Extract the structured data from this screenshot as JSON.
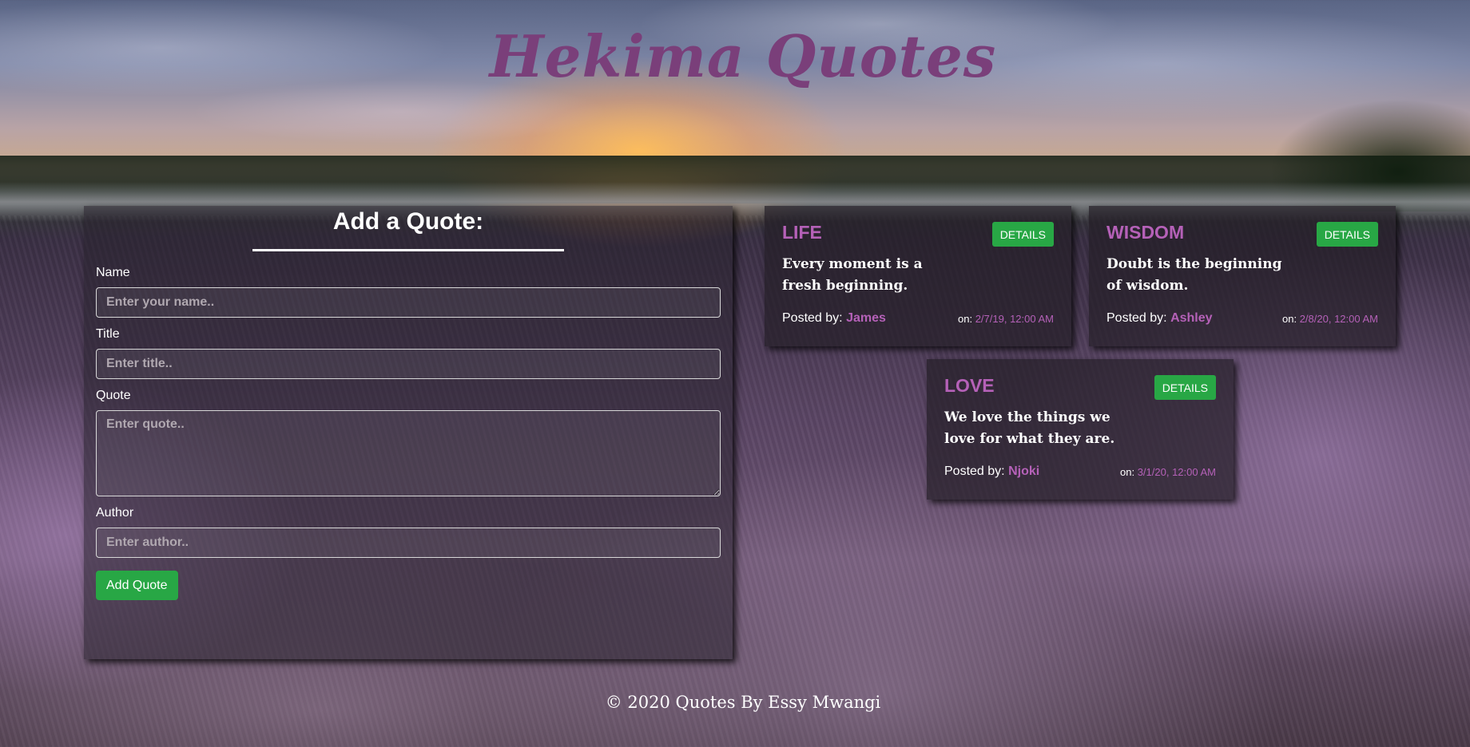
{
  "header": {
    "title": "Hekima Quotes"
  },
  "form": {
    "heading": "Add a Quote:",
    "name_label": "Name",
    "name_placeholder": "Enter your name..",
    "title_label": "Title",
    "title_placeholder": "Enter title..",
    "quote_label": "Quote",
    "quote_placeholder": "Enter quote..",
    "author_label": "Author",
    "author_placeholder": "Enter author..",
    "submit_label": "Add Quote"
  },
  "quotes": [
    {
      "title": "LIFE",
      "details_label": "DETAILS",
      "text": "Every moment is a fresh beginning.",
      "posted_by_label": "Posted by:",
      "author": "James",
      "on_label": "on:",
      "date": "2/7/19, 12:00 AM"
    },
    {
      "title": "WISDOM",
      "details_label": "DETAILS",
      "text": "Doubt is the beginning of wisdom.",
      "posted_by_label": "Posted by:",
      "author": "Ashley",
      "on_label": "on:",
      "date": "2/8/20, 12:00 AM"
    },
    {
      "title": "LOVE",
      "details_label": "DETAILS",
      "text": "We love the things we love for what they are.",
      "posted_by_label": "Posted by:",
      "author": "Njoki",
      "on_label": "on:",
      "date": "3/1/20, 12:00 AM"
    }
  ],
  "footer": {
    "text": "© 2020 Quotes By Essy Mwangi"
  },
  "colors": {
    "accent": "#b561b8",
    "title": "#7a3f7a",
    "button": "#28a745"
  }
}
